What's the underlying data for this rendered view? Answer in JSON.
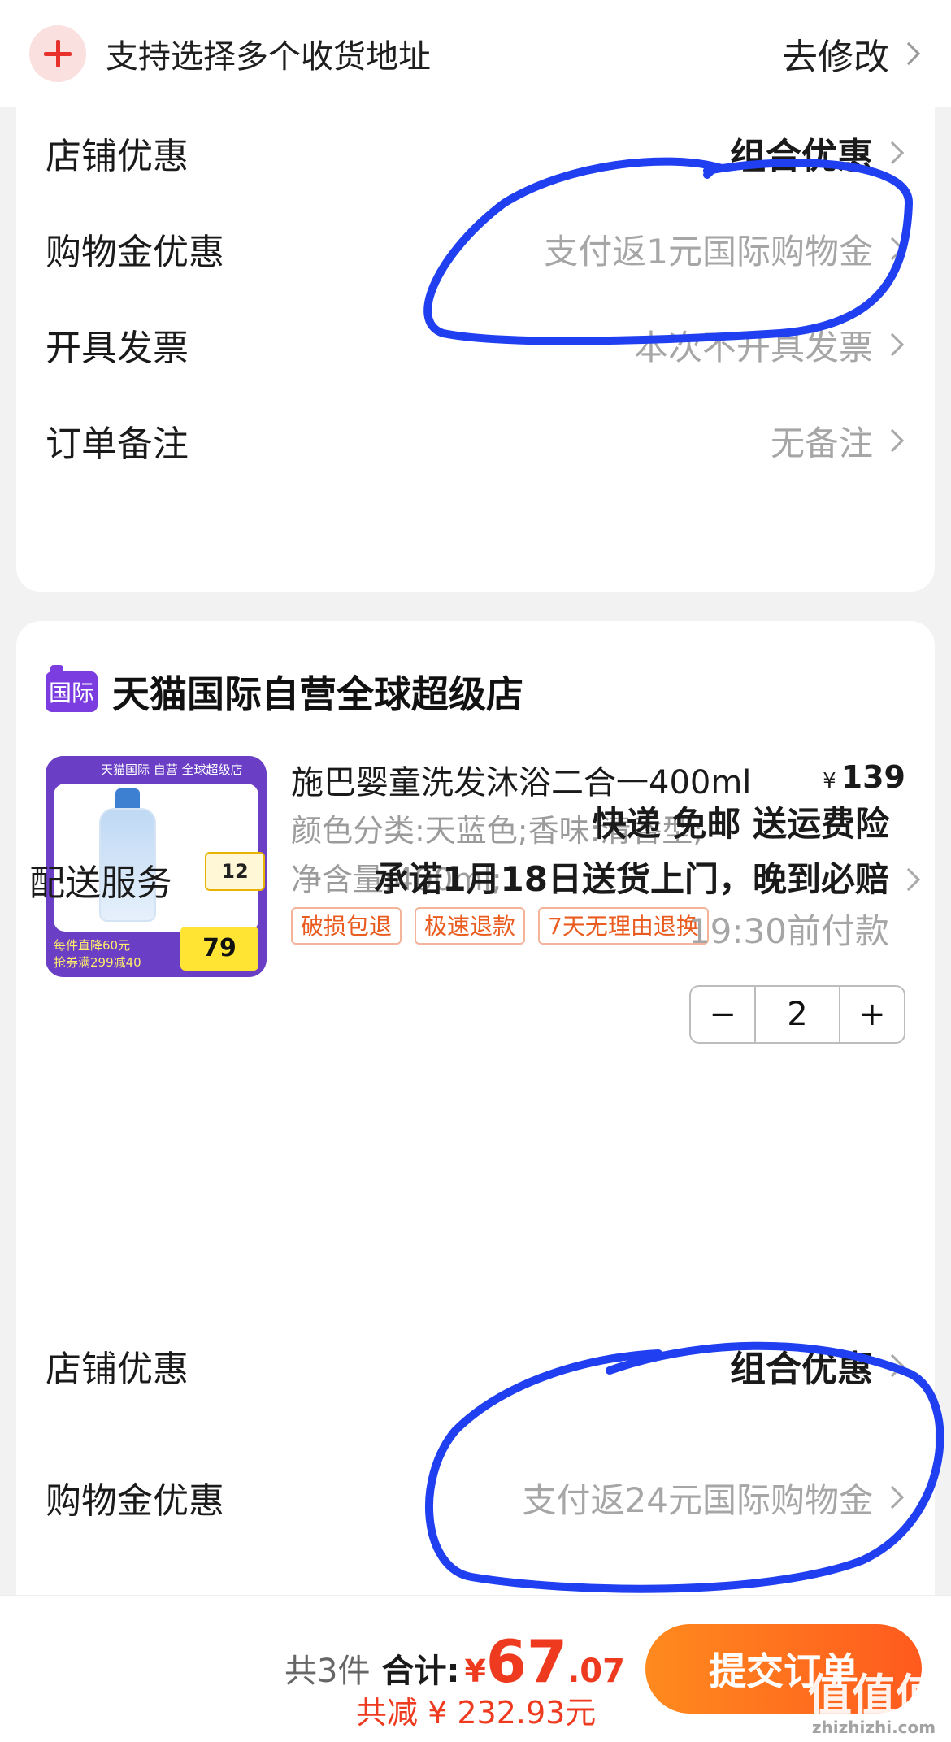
{
  "address": {
    "multi_label": "支持选择多个收货地址",
    "edit_label": "去修改"
  },
  "order_options_1": [
    {
      "label": "店铺优惠",
      "value": "组合优惠",
      "style": "bold"
    },
    {
      "label": "购物金优惠",
      "value": "支付返1元国际购物金",
      "style": "gray"
    },
    {
      "label": "开具发票",
      "value": "本次不开具发票",
      "style": "gray"
    },
    {
      "label": "订单备注",
      "value": "无备注",
      "style": "gray"
    }
  ],
  "store": {
    "badge": "国际",
    "name": "天猫国际自营全球超级店"
  },
  "product": {
    "title": "施巴婴童洗发沐浴二合一400ml",
    "currency": "¥",
    "price": "139",
    "spec_line1": "颜色分类:天蓝色;香味:清香型;",
    "spec_line2": "净含量:400ml;",
    "tags": [
      "破损包退",
      "极速退款",
      "7天无理由退换"
    ],
    "quantity": "2",
    "image": {
      "top_text": "天猫国际 自营 全球超级店",
      "promo_value": "12",
      "bottom_text_1": "每件直降60元",
      "bottom_text_2": "抢券满299减40",
      "price_value": "79"
    }
  },
  "delivery": {
    "label": "配送服务",
    "line1": "快递 免邮 送运费险",
    "line2": "承诺1月18日送货上门，晚到必赔",
    "line3": "19:30前付款"
  },
  "order_options_2": [
    {
      "label": "店铺优惠",
      "value": "组合优惠",
      "style": "bold"
    },
    {
      "label": "购物金优惠",
      "value": "支付返24元国际购物金",
      "style": "gray"
    }
  ],
  "footer": {
    "count": "共3件",
    "total_label": "合计:",
    "currency": "¥",
    "total_int": "67",
    "total_dec": ".07",
    "discount": "共减 ¥ 232.93元",
    "submit_label": "提交订单"
  },
  "watermark": {
    "text": "值值值",
    "domain": "zhizhizhi.com"
  },
  "colors": {
    "accent_red": "#ee3b1f",
    "button_orange": "#ff6a1e",
    "tag_orange": "#ea5b1f",
    "store_purple": "#7b3de0",
    "annotation_blue": "#1f3ff0"
  }
}
